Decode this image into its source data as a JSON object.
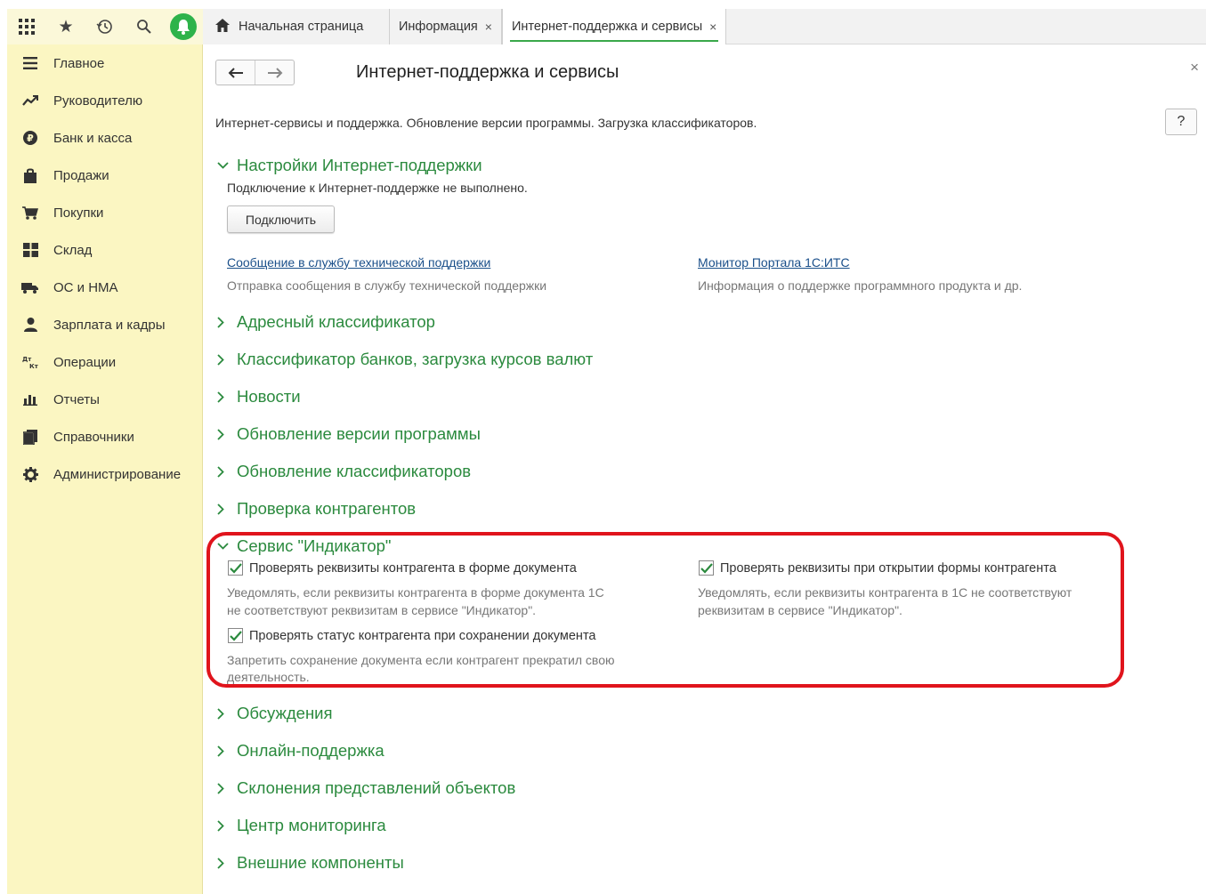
{
  "tabs": {
    "home": "Начальная страница",
    "info": "Информация",
    "active": "Интернет-поддержка и сервисы",
    "close_glyph": "×"
  },
  "sidebar": {
    "items": [
      {
        "label": "Главное",
        "icon": "menu-lines-icon"
      },
      {
        "label": "Руководителю",
        "icon": "trend-icon"
      },
      {
        "label": "Банк и касса",
        "icon": "ruble-coin-icon"
      },
      {
        "label": "Продажи",
        "icon": "shopping-bag-icon"
      },
      {
        "label": "Покупки",
        "icon": "cart-icon"
      },
      {
        "label": "Склад",
        "icon": "warehouse-grid-icon"
      },
      {
        "label": "ОС и НМА",
        "icon": "truck-icon"
      },
      {
        "label": "Зарплата и кадры",
        "icon": "person-icon"
      },
      {
        "label": "Операции",
        "icon": "dt-kt-icon"
      },
      {
        "label": "Отчеты",
        "icon": "bar-chart-icon"
      },
      {
        "label": "Справочники",
        "icon": "books-icon"
      },
      {
        "label": "Администрирование",
        "icon": "gear-icon"
      }
    ]
  },
  "page": {
    "title": "Интернет-поддержка и сервисы",
    "description": "Интернет-сервисы и поддержка. Обновление версии программы. Загрузка классификаторов.",
    "help": "?",
    "close": "×"
  },
  "support": {
    "header": "Настройки Интернет-поддержки",
    "status": "Подключение к Интернет-поддержке не выполнено.",
    "connect_button": "Подключить",
    "link1": "Сообщение в службу технической поддержки",
    "link1_hint": "Отправка сообщения в службу технической поддержки",
    "link2": "Монитор Портала 1С:ИТС",
    "link2_hint": "Информация о поддержке программного продукта и др."
  },
  "groups_before": [
    "Адресный классификатор",
    "Классификатор банков, загрузка курсов валют",
    "Новости",
    "Обновление версии программы",
    "Обновление классификаторов",
    "Проверка контрагентов"
  ],
  "indicator": {
    "header": "Сервис \"Индикатор\"",
    "cb1_label": "Проверять реквизиты контрагента в форме документа",
    "cb1_hint1": "Уведомлять, если реквизиты контрагента в форме документа 1С",
    "cb1_hint2": "не соответствуют реквизитам в сервисе \"Индикатор\".",
    "cb2_label": "Проверять реквизиты при открытии формы контрагента",
    "cb2_hint1": "Уведомлять, если реквизиты контрагента в 1С не соответствуют",
    "cb2_hint2": "реквизитам в сервисе \"Индикатор\".",
    "cb3_label": "Проверять статус контрагента при сохранении документа",
    "cb3_hint1": "Запретить сохранение документа если контрагент прекратил свою",
    "cb3_hint2": "деятельность."
  },
  "groups_after": [
    "Обсуждения",
    "Онлайн-поддержка",
    "Склонения представлений объектов",
    "Центр мониторинга",
    "Внешние компоненты"
  ],
  "colors": {
    "accent_green": "#2b8a3e",
    "sidebar_bg": "#fbf6c2",
    "highlight_red": "#e0141c",
    "link_blue": "#1a4f8a"
  }
}
